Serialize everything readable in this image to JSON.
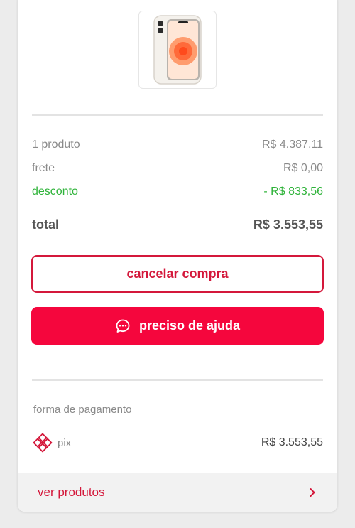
{
  "product": {
    "image_icon": "phone-image"
  },
  "summary": {
    "products_label": "1 produto",
    "products_value": "R$ 4.387,11",
    "shipping_label": "frete",
    "shipping_value": "R$ 0,00",
    "discount_label": "desconto",
    "discount_value": "- R$ 833,56",
    "total_label": "total",
    "total_value": "R$ 3.553,55"
  },
  "actions": {
    "cancel_label": "cancelar compra",
    "help_label": "preciso de ajuda",
    "help_icon": "chat-bubble-icon"
  },
  "payment": {
    "section_label": "forma de pagamento",
    "method_label": "pix",
    "method_icon": "pix-icon",
    "amount": "R$ 3.553,55"
  },
  "footer": {
    "view_products_label": "ver produtos",
    "chevron_icon": "chevron-right-icon"
  },
  "colors": {
    "brand_red": "#f5063d",
    "outline_red": "#d4183b",
    "discount_green": "#2fb33a"
  }
}
